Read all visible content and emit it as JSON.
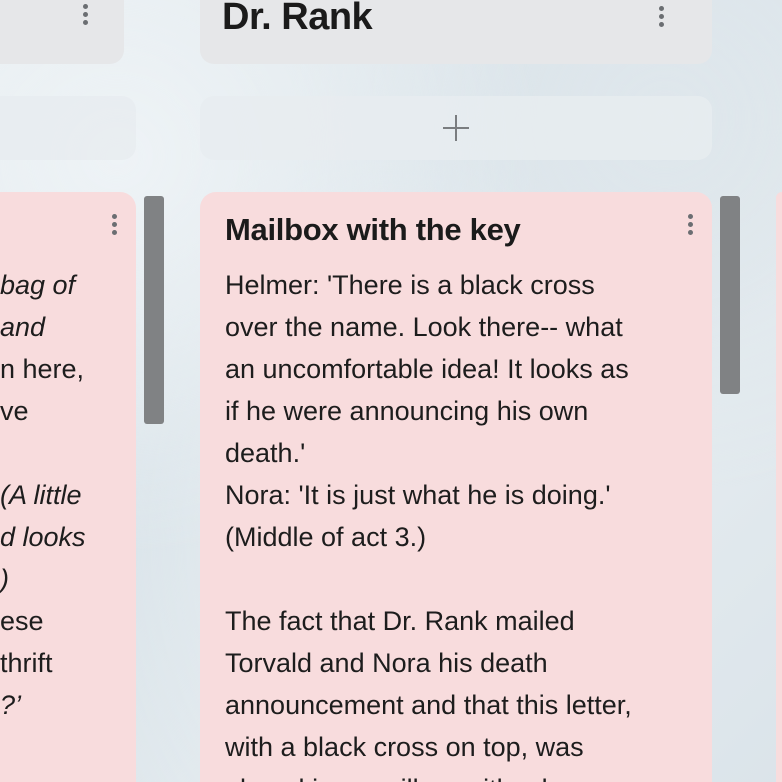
{
  "left_column": {
    "card_lines": [
      {
        "text": "bag of",
        "italic": true
      },
      {
        "text": " and",
        "italic": true
      },
      {
        "text": "n here,",
        "italic": false
      },
      {
        "text": "ve",
        "italic": false
      },
      {
        "text": "",
        "italic": false
      },
      {
        "text": "(A little",
        "italic": true
      },
      {
        "text": "d looks",
        "italic": true
      },
      {
        "text": ")",
        "italic": true
      },
      {
        "text": "ese",
        "italic": false
      },
      {
        "text": "thrift",
        "italic": false
      },
      {
        "text": "?’",
        "italic": true
      }
    ]
  },
  "main_column": {
    "title": "Dr. Rank",
    "card": {
      "title": "Mailbox with the key",
      "body": "Helmer: 'There is a black cross\nover the name. Look there-- what\nan uncomfortable idea! It looks as\nif he were announcing his own\ndeath.'\nNora: 'It is just what he is doing.'\n(Middle of act 3.)\n\nThe fact that Dr. Rank mailed\nTorvald and Nora his death\nannouncement and that this letter,\nwith a black cross on top, was\nplaced in a mailbox with a key"
    }
  },
  "icons": {
    "menu": "more-vertical-icon",
    "add": "plus-icon"
  },
  "colors": {
    "card_background": "#f8dcdd",
    "header_background": "#e6e7e9",
    "scrollbar": "#808284"
  }
}
